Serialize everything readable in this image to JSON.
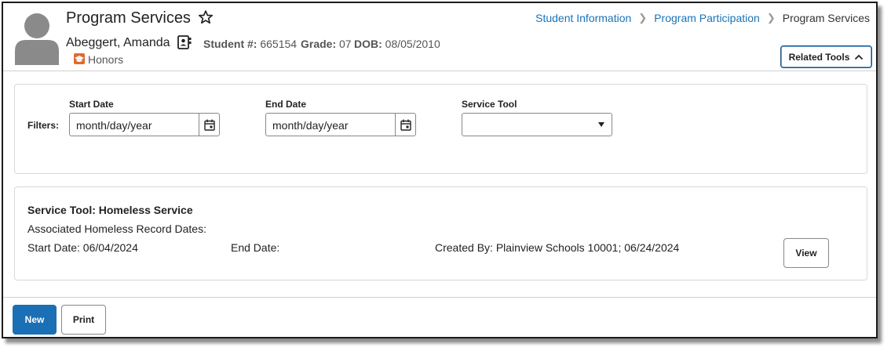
{
  "header": {
    "title": "Program Services",
    "student_name": "Abeggert, Amanda",
    "student_number_label": "Student #:",
    "student_number": "665154",
    "grade_label": "Grade:",
    "grade": "07",
    "dob_label": "DOB:",
    "dob": "08/05/2010",
    "flag_label": "Honors",
    "flag_icon": "graduation-cap-icon",
    "flag_color": "#e06a2c",
    "related_tools_label": "Related Tools"
  },
  "breadcrumb": {
    "items": [
      "Student Information",
      "Program Participation",
      "Program Services"
    ]
  },
  "filters": {
    "label": "Filters:",
    "start_date_label": "Start Date",
    "start_date_placeholder": "month/day/year",
    "end_date_label": "End Date",
    "end_date_placeholder": "month/day/year",
    "service_tool_label": "Service Tool",
    "service_tool_value": ""
  },
  "service": {
    "title": "Service Tool: Homeless Service",
    "associated_dates_label": "Associated Homeless Record Dates:",
    "start_date": "Start Date: 06/04/2024",
    "end_date": "End Date:",
    "created_by": "Created By: Plainview Schools 10001; 06/24/2024",
    "view_label": "View"
  },
  "footer": {
    "new_label": "New",
    "print_label": "Print"
  },
  "colors": {
    "link": "#1a73b8",
    "primary_button": "#1b6fb5"
  }
}
